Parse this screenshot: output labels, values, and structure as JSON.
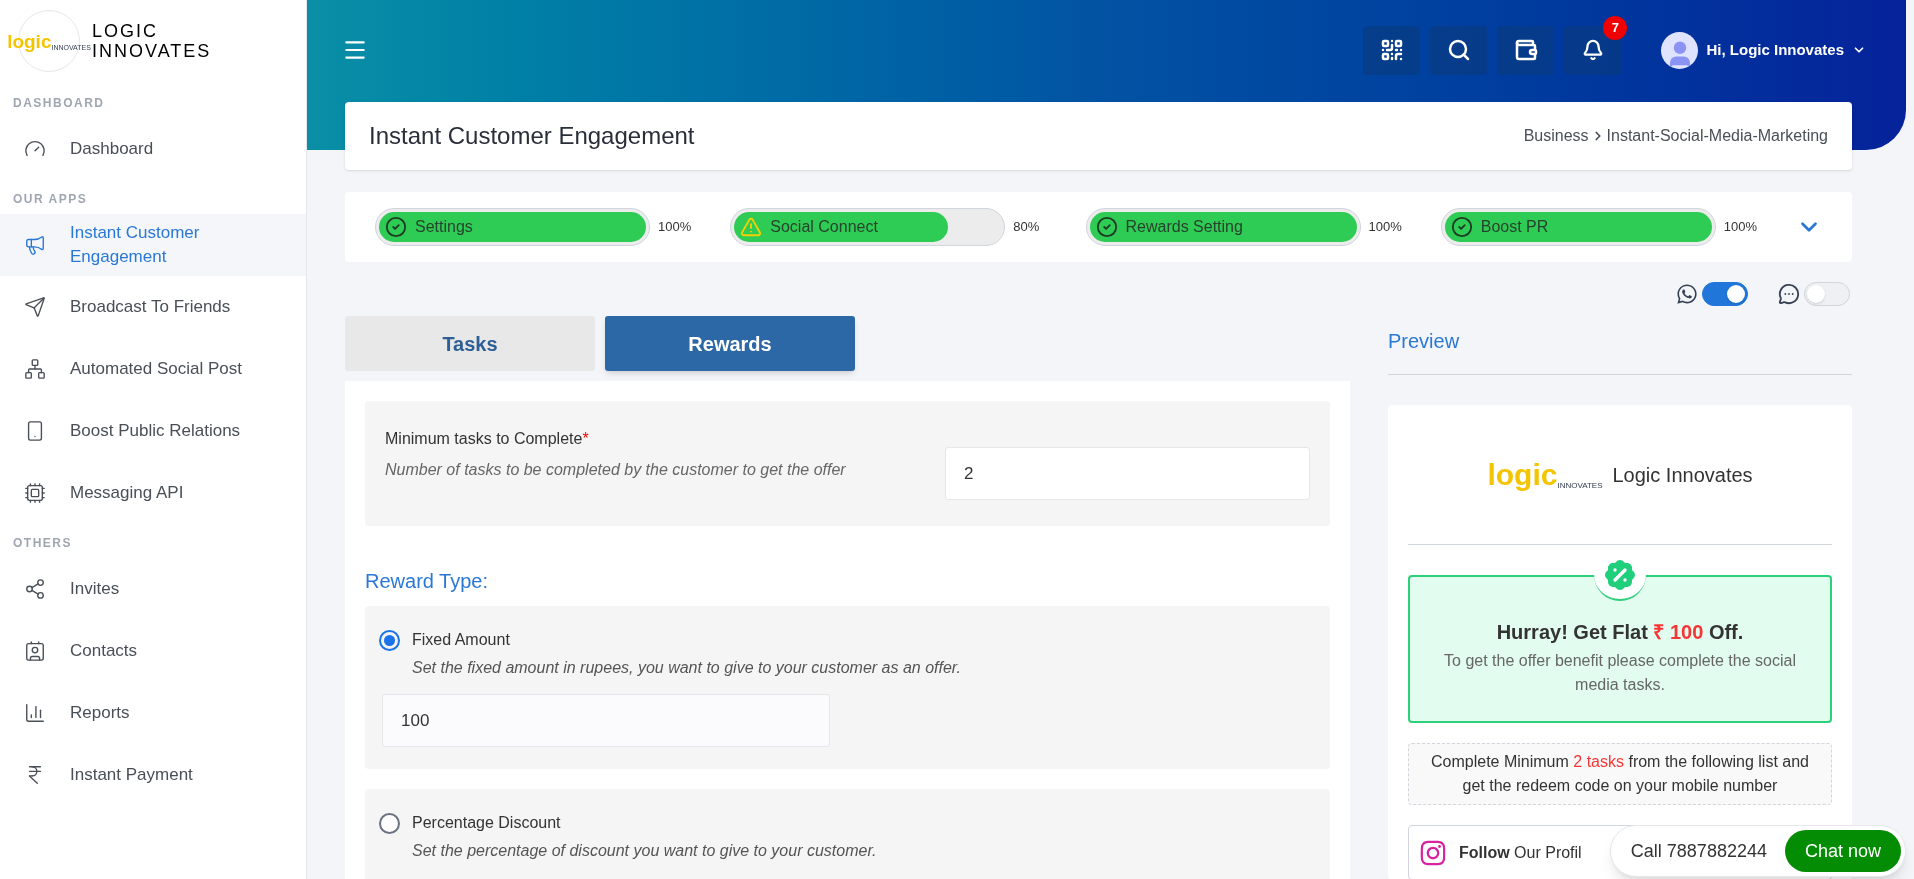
{
  "brand": {
    "logo_word": "logic",
    "logo_small": "INNOVATES",
    "name_line1": "LOGIC",
    "name_line2": "INNOVATES"
  },
  "sidebar": [
    {
      "title": "DASHBOARD",
      "items": [
        {
          "label": "Dashboard",
          "selected": false
        }
      ]
    },
    {
      "title": "OUR APPS",
      "items": [
        {
          "label": "Instant Customer Engagement",
          "selected": true
        },
        {
          "label": "Broadcast To Friends",
          "selected": false
        },
        {
          "label": "Automated Social Post",
          "selected": false
        },
        {
          "label": "Boost Public Relations",
          "selected": false
        },
        {
          "label": "Messaging API",
          "selected": false
        }
      ]
    },
    {
      "title": "OTHERS",
      "items": [
        {
          "label": "Invites",
          "selected": false
        },
        {
          "label": "Contacts",
          "selected": false
        },
        {
          "label": "Reports",
          "selected": false
        },
        {
          "label": "Instant Payment",
          "selected": false
        }
      ]
    }
  ],
  "topbar": {
    "notification_count": "7",
    "greeting": "Hi, Logic Innovates"
  },
  "page": {
    "title": "Instant Customer Engagement",
    "breadcrumb": [
      "Business",
      "Instant-Social-Media-Marketing"
    ]
  },
  "progress": [
    {
      "label": "Settings",
      "kind": "done",
      "level": 1,
      "reading": "100%"
    },
    {
      "label": "Social Connect",
      "kind": "warning",
      "level": 0.8,
      "reading": "80%"
    },
    {
      "label": "Rewards Setting",
      "kind": "done",
      "level": 1,
      "reading": "100%"
    },
    {
      "label": "Boost PR",
      "kind": "done",
      "level": 1,
      "reading": "100%"
    }
  ],
  "toggles": [
    {
      "kind": "whatsapp",
      "on": true
    },
    {
      "kind": "sms",
      "on": false
    }
  ],
  "tabs": [
    {
      "label": "Tasks",
      "selected": false
    },
    {
      "label": "Rewards",
      "selected": true
    }
  ],
  "min_tasks": {
    "label": "Minimum tasks to Complete",
    "required_mark": "*",
    "hint": "Number of tasks to be completed by the customer to get the offer",
    "value": "2"
  },
  "reward_type": {
    "heading": "Reward Type:",
    "options": [
      {
        "label": "Fixed Amount",
        "hint": "Set the fixed amount in rupees, you want to give to your customer as an offer.",
        "selected": true,
        "value": "100"
      },
      {
        "label": "Percentage Discount",
        "hint": "Set the percentage of discount you want to give to your customer.",
        "selected": false
      }
    ]
  },
  "preview": {
    "heading": "Preview",
    "logo_word": "logic",
    "logo_small": "INNOVATES",
    "business_name": "Logic Innovates",
    "offer_before": "Hurray! Get Flat",
    "offer_amount": "₹ 100",
    "offer_after": "Off.",
    "offer_text": "To get the offer benefit please complete the social media tasks.",
    "tasks_before": "Complete Minimum",
    "tasks_count": "2 tasks",
    "tasks_after": "from the following list and get the redeem code on your mobile number",
    "task_row": "**Follow** Our Profil"
  },
  "chat_widget": {
    "call": "Call 7887882244",
    "button": "Chat now"
  }
}
